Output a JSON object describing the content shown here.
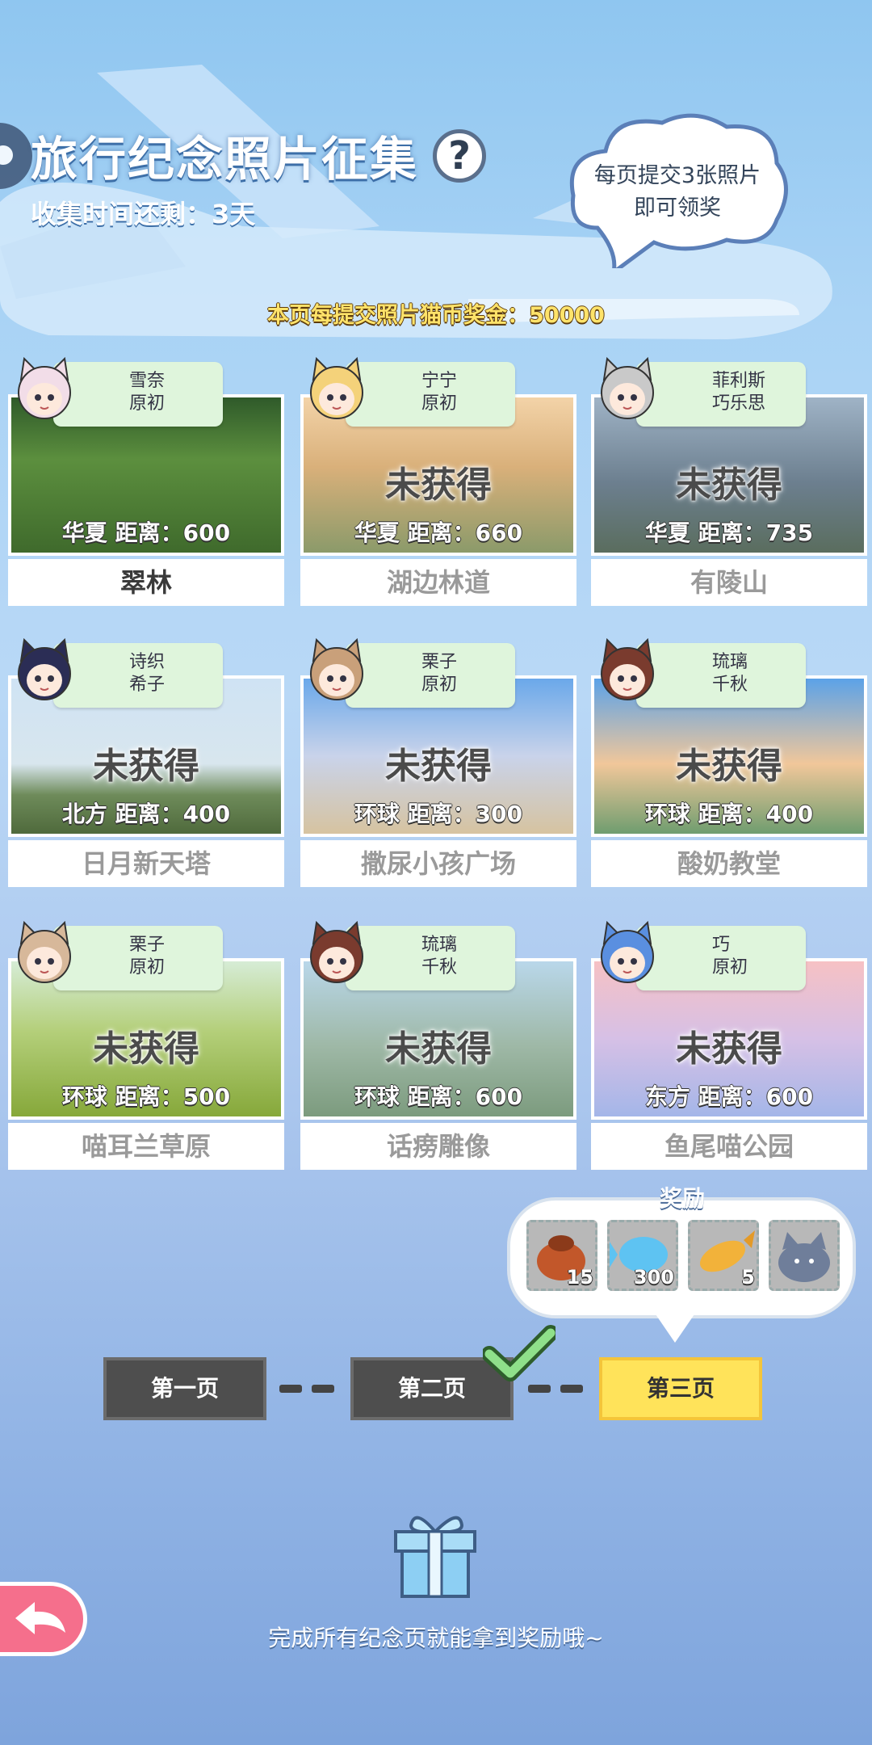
{
  "header": {
    "title": "旅行纪念照片征集",
    "help_glyph": "?",
    "timer": "收集时间还剩：3天"
  },
  "cloud_tip": {
    "line1": "每页提交3张照片",
    "line2": "即可领奖"
  },
  "bonus": "本页每提交照片猫币奖金：50000",
  "unobtained_label": "未获得",
  "cards": [
    {
      "char1": "雪奈",
      "char2": "原初",
      "region": "华夏  距离：600",
      "name": "翠林",
      "obtained": true
    },
    {
      "char1": "宁宁",
      "char2": "原初",
      "region": "华夏  距离：660",
      "name": "湖边林道",
      "obtained": false
    },
    {
      "char1": "菲利斯",
      "char2": "巧乐思",
      "region": "华夏  距离：735",
      "name": "有陵山",
      "obtained": false
    },
    {
      "char1": "诗织",
      "char2": "希子",
      "region": "北方  距离：400",
      "name": "日月新天塔",
      "obtained": false
    },
    {
      "char1": "栗子",
      "char2": "原初",
      "region": "环球  距离：300",
      "name": "撒尿小孩广场",
      "obtained": false
    },
    {
      "char1": "琉璃",
      "char2": "千秋",
      "region": "环球  距离：400",
      "name": "酸奶教堂",
      "obtained": false
    },
    {
      "char1": "栗子",
      "char2": "原初",
      "region": "环球  距离：500",
      "name": "喵耳兰草原",
      "obtained": false
    },
    {
      "char1": "琉璃",
      "char2": "千秋",
      "region": "环球  距离：600",
      "name": "话痨雕像",
      "obtained": false
    },
    {
      "char1": "巧",
      "char2": "原初",
      "region": "东方  距离：600",
      "name": "鱼尾喵公园",
      "obtained": false
    }
  ],
  "rewards": {
    "title": "奖励",
    "items": [
      {
        "icon": "dried-fish-bag-icon",
        "count": "15"
      },
      {
        "icon": "blue-fish-icon",
        "count": "300"
      },
      {
        "icon": "taiyaki-icon",
        "count": "5"
      },
      {
        "icon": "cat-plush-icon",
        "count": ""
      }
    ]
  },
  "pages": [
    {
      "label": "第一页",
      "state": "done"
    },
    {
      "label": "第二页",
      "state": "checked"
    },
    {
      "label": "第三页",
      "state": "active"
    }
  ],
  "footer": "完成所有纪念页就能拿到奖励哦~",
  "colors": {
    "active_page": "#ffe35a",
    "tag_bg": "#dff5dc",
    "back_button": "#f56f8c"
  }
}
